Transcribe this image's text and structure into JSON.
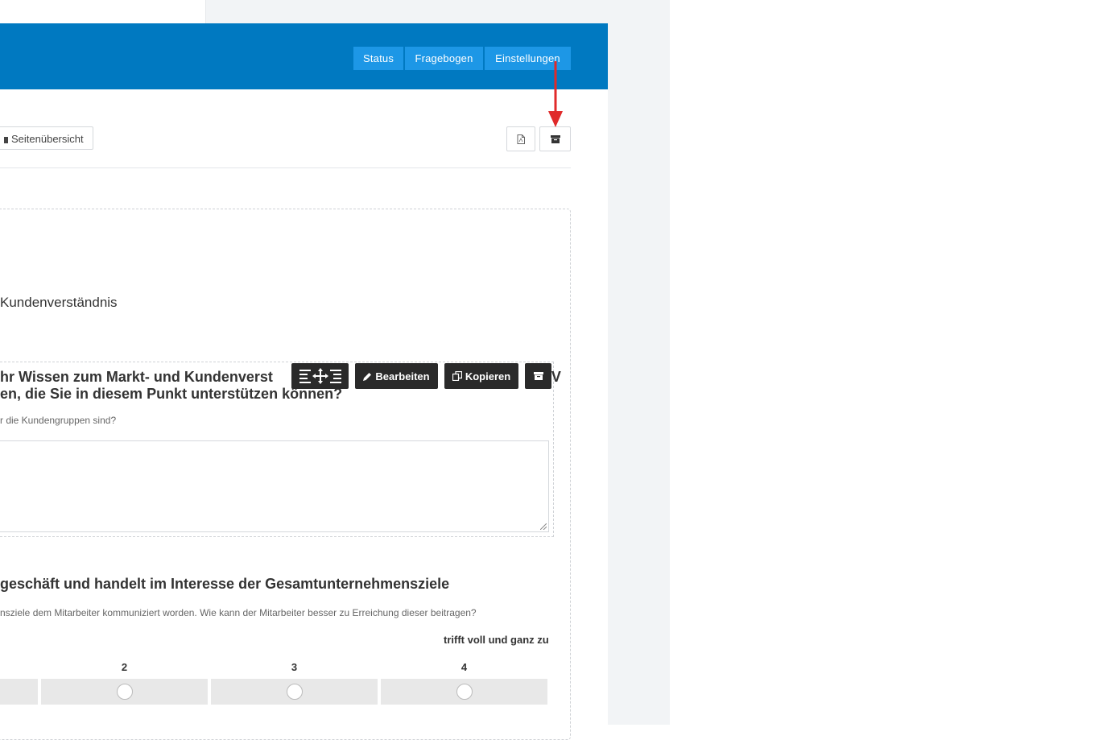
{
  "header": {
    "tabs": [
      {
        "label": "Status"
      },
      {
        "label": "Fragebogen"
      },
      {
        "label": "Einstellungen"
      }
    ]
  },
  "toolbar": {
    "page_overview_label": "Seitenübersicht",
    "pdf_icon": "pdf-file-icon",
    "archive_icon": "archive-icon"
  },
  "section": {
    "title": "Kundenverständnis"
  },
  "question1": {
    "title_line1": "hr Wissen zum Markt- und Kundenverst",
    "title_line1_tail": "V",
    "title_line2": "en, die Sie in diesem Punkt unterstützen können?",
    "hint": "r die Kundengruppen sind?",
    "actions": {
      "move_icon": "move-arrows-icon",
      "edit_label": "Bearbeiten",
      "copy_label": "Kopieren",
      "archive_icon": "archive-icon"
    }
  },
  "question2": {
    "title": "geschäft und handelt im Interesse der Gesamtunternehmensziele",
    "hint": "nsziele dem Mitarbeiter kommuniziert worden. Wie kann der Mitarbeiter besser zu Erreichung dieser beitragen?",
    "scale_max_label": "trifft voll und ganz zu",
    "scale": [
      "2",
      "3",
      "4"
    ]
  },
  "colors": {
    "header": "#0079c1",
    "tab": "#1d97e6",
    "action_button": "#2a2a2a",
    "arrow": "#e02a2a"
  }
}
